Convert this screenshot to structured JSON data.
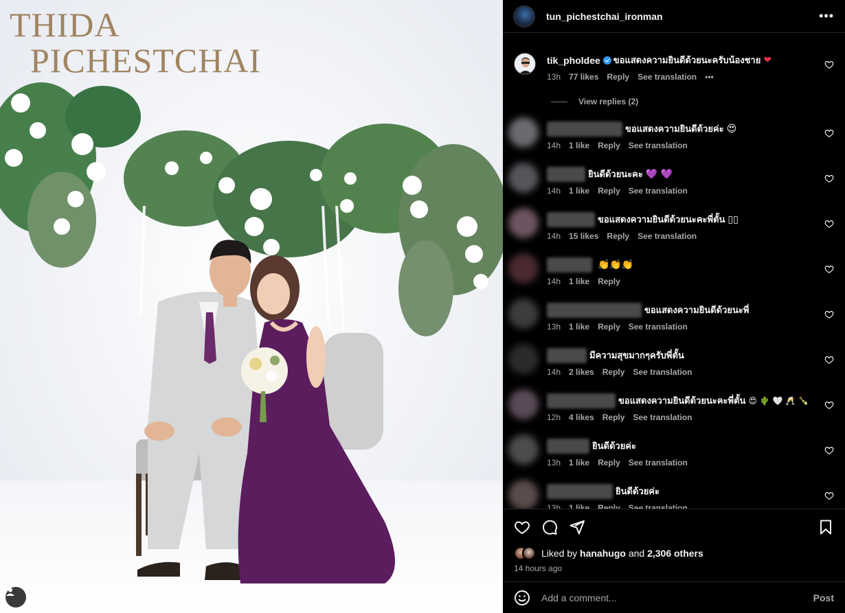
{
  "photo": {
    "title_line1": "THIDA",
    "title_line2": "PICHESTCHAI"
  },
  "header": {
    "username": "tun_pichestchai_ironman",
    "more_label": "•••"
  },
  "comments": [
    {
      "username": "tik_pholdee",
      "verified": true,
      "text": "ขอแสดงความยินดีด้วยนะครับน้องชาย",
      "emoji": "❤",
      "time": "13h",
      "likes": "77 likes",
      "reply": "Reply",
      "translate": "See translation",
      "more": "•••",
      "view_replies": "View replies (2)"
    },
    {
      "text": "ขอแสดงความยินดีด้วยค่ะ",
      "emoji": "😍",
      "time": "14h",
      "likes": "1 like",
      "reply": "Reply",
      "translate": "See translation"
    },
    {
      "text": "ยินดีด้วยนะคะ",
      "emoji": "💜 💜",
      "time": "14h",
      "likes": "1 like",
      "reply": "Reply",
      "translate": "See translation"
    },
    {
      "text": "ขอแสดงความยินดีด้วยนะคะพี่ตั้น",
      "emoji": "▯▯",
      "time": "14h",
      "likes": "15 likes",
      "reply": "Reply",
      "translate": "See translation"
    },
    {
      "text": "",
      "emoji": "👏👏👏",
      "time": "14h",
      "likes": "1 like",
      "reply": "Reply",
      "translate": ""
    },
    {
      "text": "ขอแสดงความยินดีด้วยนะพี่",
      "emoji": "",
      "time": "13h",
      "likes": "1 like",
      "reply": "Reply",
      "translate": "See translation"
    },
    {
      "text": "มีความสุขมากๆครับพี่ตั้น",
      "emoji": "",
      "time": "14h",
      "likes": "2 likes",
      "reply": "Reply",
      "translate": "See translation"
    },
    {
      "text": "ขอแสดงความยินดีด้วยนะคะพี่ตั้น",
      "emoji": "😍 🌵 🤍 🥂 🍾",
      "time": "12h",
      "likes": "4 likes",
      "reply": "Reply",
      "translate": "See translation"
    },
    {
      "text": "ยินดีด้วยค่ะ",
      "emoji": "",
      "time": "13h",
      "likes": "1 like",
      "reply": "Reply",
      "translate": "See translation"
    },
    {
      "text": "ยินดีด้วยค่ะ",
      "emoji": "",
      "time": "13h",
      "likes": "1 like",
      "reply": "Reply",
      "translate": "See translation"
    }
  ],
  "actions": {
    "liked_by_prefix": "Liked by",
    "liked_by_user": "hanahugo",
    "liked_by_and": "and",
    "liked_by_others": "2,306 others",
    "timestamp": "14 hours ago"
  },
  "add_comment": {
    "placeholder": "Add a comment...",
    "post_label": "Post"
  },
  "colors": {
    "background": "#000000",
    "text_primary": "#f5f5f5",
    "text_secondary": "#a8a8a8",
    "verified": "#3797f0",
    "title_gold": "#a08461",
    "dress_purple": "#5b1d5e"
  }
}
